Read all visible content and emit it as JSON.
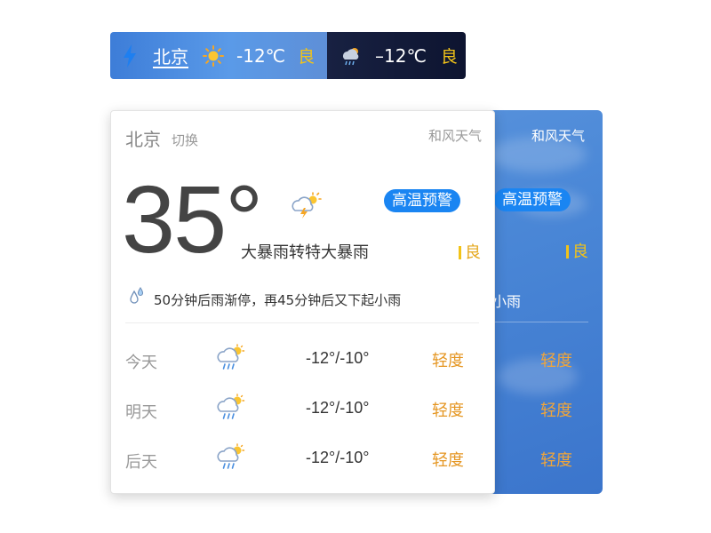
{
  "mini_bar_light": {
    "city": "北京",
    "temp": "-12℃",
    "aqi": "良",
    "accent": "#4a86dc"
  },
  "mini_bar_dark": {
    "temp": "–12℃",
    "aqi": "良",
    "accent": "#121a38"
  },
  "back_card": {
    "provider": "和风天气",
    "alert": "高温预警",
    "aqi": "良",
    "rain_note_tail": "小雨",
    "forecast": [
      {
        "level": "轻度"
      },
      {
        "level": "轻度"
      },
      {
        "level": "轻度"
      }
    ]
  },
  "card": {
    "city": "北京",
    "switch_label": "切换",
    "provider": "和风天气",
    "temperature": "35°",
    "condition": "大暴雨转特大暴雨",
    "alert": "高温预警",
    "aqi": "良",
    "rain_note": "50分钟后雨渐停，再45分钟后又下起小雨",
    "forecast": [
      {
        "day": "今天",
        "icon": "rain-sun-icon",
        "range": "-12°/-10°",
        "level": "轻度"
      },
      {
        "day": "明天",
        "icon": "rain-sun-icon",
        "range": "-12°/-10°",
        "level": "轻度"
      },
      {
        "day": "后天",
        "icon": "rain-sun-icon",
        "range": "-12°/-10°",
        "level": "轻度"
      }
    ]
  },
  "colors": {
    "alert_blue": "#1a85f2",
    "aqi_yellow": "#f2c318",
    "level_orange": "#e59622"
  }
}
